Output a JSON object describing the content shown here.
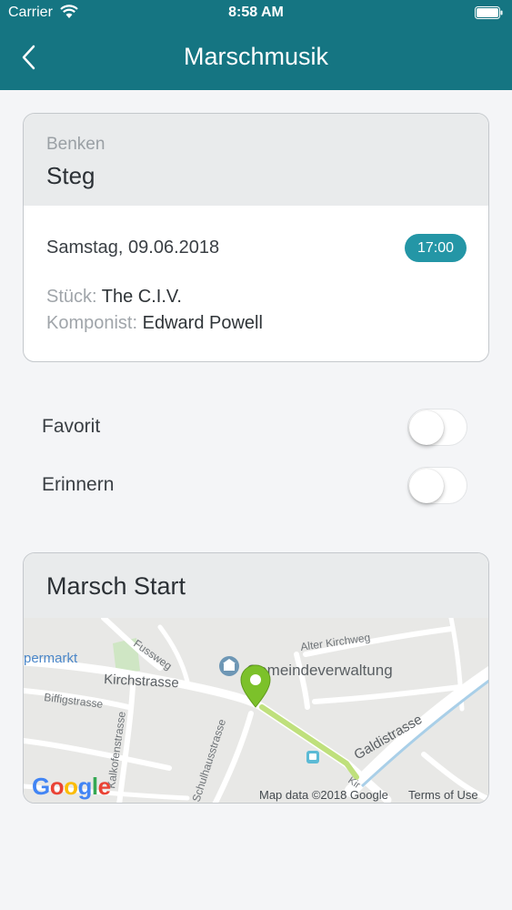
{
  "status_bar": {
    "carrier": "Carrier",
    "time": "8:58 AM"
  },
  "header": {
    "title": "Marschmusik",
    "back_icon": "chevron-left-icon",
    "background_color": "#157582"
  },
  "event": {
    "location_sub": "Benken",
    "location": "Steg",
    "date": "Samstag, 09.06.2018",
    "time": "17:00",
    "piece_label": "Stück:",
    "piece": "The C.I.V.",
    "composer_label": "Komponist:",
    "composer": "Edward Powell",
    "badge_color": "#2496a6"
  },
  "toggles": {
    "favorite_label": "Favorit",
    "favorite_on": false,
    "reminder_label": "Erinnern",
    "reminder_on": false
  },
  "map": {
    "title": "Marsch Start",
    "streets": {
      "supermarkt": "permarkt",
      "fussweg": "Fussweg",
      "alter_kirchweg": "Alter Kirchweg",
      "gemeindeverwaltung": "Gemeindeverwaltung",
      "kirchstrasse": "Kirchstrasse",
      "biffigstrasse": "Biffigstrasse",
      "kalkofenstrasse": "Kalkofenstrasse",
      "schulhausstrasse": "Schulhausstrasse",
      "galdistrasse": "Galdistrasse",
      "kir": "Kir"
    },
    "logo": [
      "G",
      "o",
      "o",
      "g",
      "l",
      "e"
    ],
    "attribution": "Map data ©2018 Google",
    "terms": "Terms of Use",
    "pin_icon": "map-pin-icon",
    "pin_color": "#7cc12a"
  }
}
